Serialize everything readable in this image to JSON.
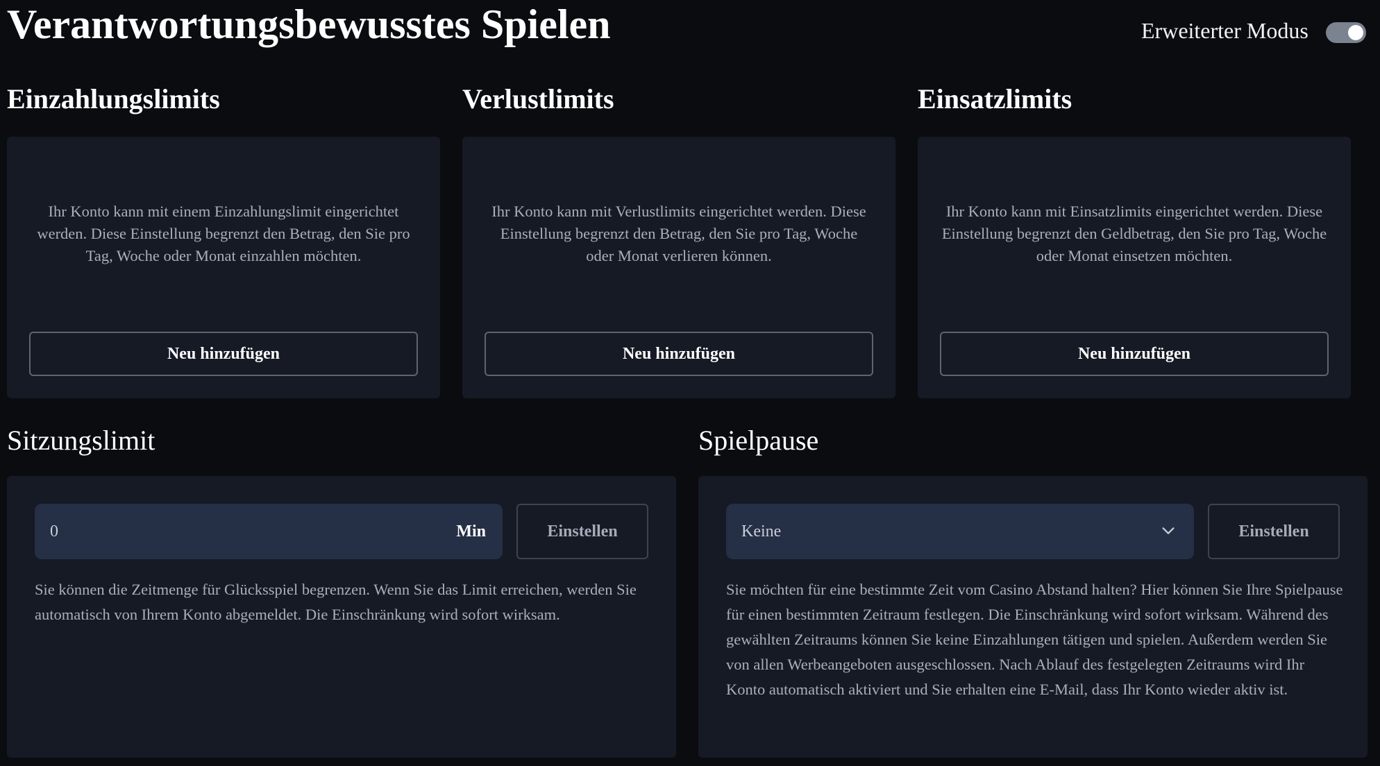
{
  "header": {
    "title": "Verantwortungsbewusstes Spielen",
    "mode_label": "Erweiterter Modus",
    "mode_enabled": true
  },
  "limits": [
    {
      "title": "Einzahlungslimits",
      "description": "Ihr Konto kann mit einem Einzahlungslimit eingerichtet werden. Diese Einstellung begrenzt den Betrag, den Sie pro Tag, Woche oder Monat einzahlen möchten.",
      "button_label": "Neu hinzufügen"
    },
    {
      "title": "Verlustlimits",
      "description": "Ihr Konto kann mit Verlustlimits eingerichtet werden. Diese Einstellung begrenzt den Betrag, den Sie pro Tag, Woche oder Monat verlieren können.",
      "button_label": "Neu hinzufügen"
    },
    {
      "title": "Einsatzlimits",
      "description": "Ihr Konto kann mit Einsatzlimits eingerichtet werden. Diese Einstellung begrenzt den Geldbetrag, den Sie pro Tag, Woche oder Monat einsetzen möchten.",
      "button_label": "Neu hinzufügen"
    }
  ],
  "session": {
    "title": "Sitzungslimit",
    "input_value": "0",
    "unit": "Min",
    "button_label": "Einstellen",
    "description": "Sie können die Zeitmenge für Glücksspiel begrenzen. Wenn Sie das Limit erreichen, werden Sie automatisch von Ihrem Konto abgemeldet. Die Einschränkung wird sofort wirksam."
  },
  "pause": {
    "title": "Spielpause",
    "selected_option": "Keine",
    "button_label": "Einstellen",
    "description": "Sie möchten für eine bestimmte Zeit vom Casino Abstand halten? Hier können Sie Ihre Spielpause für einen bestimmten Zeitraum festlegen. Die Einschränkung wird sofort wirksam. Während des gewählten Zeitraums können Sie keine Einzahlungen tätigen und spielen. Außerdem werden Sie von allen Werbeangeboten ausgeschlossen. Nach Ablauf des festgelegten Zeitraums wird Ihr Konto automatisch aktiviert und Sie erhalten eine E-Mail, dass Ihr Konto wieder aktiv ist."
  },
  "colors": {
    "background": "#0b0c10",
    "card": "#151a25",
    "input": "#252f45",
    "toggle": "#7b8290"
  },
  "icons": {
    "dropdown": "chevron-down-icon"
  }
}
